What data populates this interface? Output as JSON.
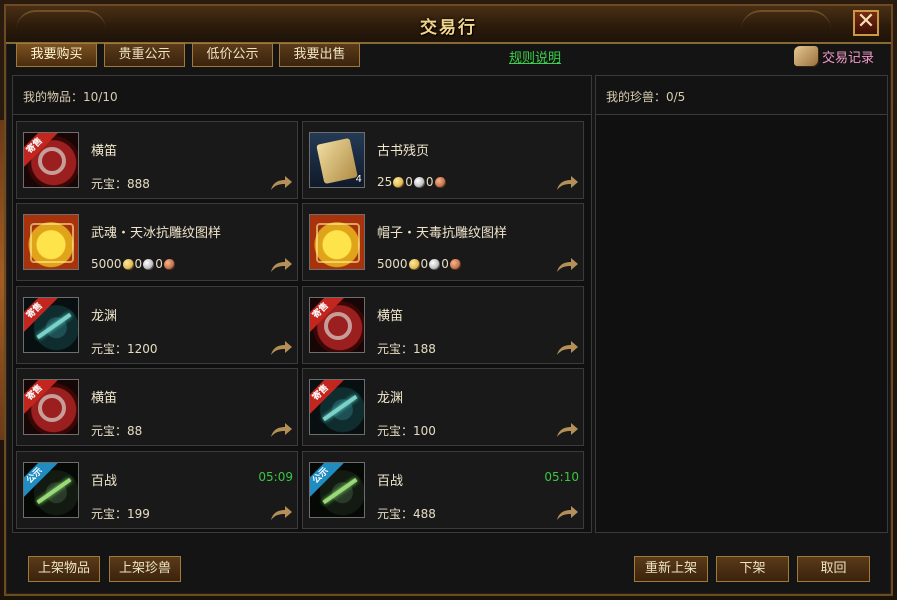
{
  "window": {
    "title": "交易行"
  },
  "tabs": [
    {
      "label": "我要购买"
    },
    {
      "label": "贵重公示"
    },
    {
      "label": "低价公示"
    },
    {
      "label": "我要出售"
    }
  ],
  "rules_link": "规则说明",
  "history_label": "交易记录",
  "left_panel": {
    "header": "我的物品：10/10"
  },
  "right_panel": {
    "header": "我的珍兽：0/5"
  },
  "items": [
    {
      "name": "横笛",
      "price_text": "元宝：888",
      "icon": "flute-icon",
      "ribbon": "寄售"
    },
    {
      "name": "古书残页",
      "qty": "4",
      "coins": [
        "25",
        "0",
        "0"
      ],
      "icon": "scroll-icon"
    },
    {
      "name": "武魂・天冰抗雕纹图样",
      "coins": [
        "5000",
        "0",
        "0"
      ],
      "icon": "pattern-icon"
    },
    {
      "name": "帽子・天毒抗雕纹图样",
      "coins": [
        "5000",
        "0",
        "0"
      ],
      "icon": "pattern-icon"
    },
    {
      "name": "龙渊",
      "price_text": "元宝：1200",
      "icon": "dragon-weapon-icon",
      "ribbon": "寄售"
    },
    {
      "name": "横笛",
      "price_text": "元宝：188",
      "icon": "flute-icon",
      "ribbon": "寄售"
    },
    {
      "name": "横笛",
      "price_text": "元宝：88",
      "icon": "flute-icon",
      "ribbon": "寄售"
    },
    {
      "name": "龙渊",
      "price_text": "元宝：100",
      "icon": "dragon-weapon-icon",
      "ribbon": "寄售"
    },
    {
      "name": "百战",
      "price_text": "元宝：199",
      "timer": "05:09",
      "icon": "baizhan-weapon-icon",
      "ribbon": "公示"
    },
    {
      "name": "百战",
      "price_text": "元宝：488",
      "timer": "05:10",
      "icon": "baizhan-weapon-icon",
      "ribbon": "公示"
    }
  ],
  "bottom_buttons": {
    "list_item": "上架物品",
    "list_pet": "上架珍兽",
    "relist": "重新上架",
    "delist": "下架",
    "cancel": "取回"
  }
}
